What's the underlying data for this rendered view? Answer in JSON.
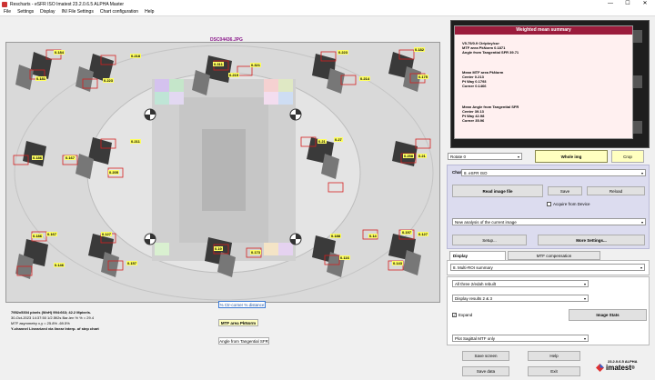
{
  "window": {
    "title": "Rescharts - eSFR ISO    Imatest 23.2.0.6.5  ALPHA  Master",
    "controls": [
      "—",
      "☐",
      "✕"
    ]
  },
  "menu": [
    "File",
    "Settings",
    "Display",
    "INI File Settings",
    "Chart configuration",
    "Help"
  ],
  "image": {
    "filename": "DSC04436.JPG",
    "labels": [
      "0.184",
      "0.218",
      "0.311",
      "0.321",
      "0.223",
      "0.182",
      "0.181",
      "0.223",
      "0.215",
      "0.214",
      "0.175",
      "0.186",
      "0.167",
      "0.211",
      "0.205",
      "0.21",
      "0.27",
      "0.258",
      "0.21",
      "0.186",
      "0.167",
      "0.127",
      "0.19",
      "0.173",
      "0.188",
      "0.14",
      "0.197",
      "0.127",
      "0.146",
      "0.157",
      "0.116",
      "0.143"
    ]
  },
  "info": {
    "line1": "7952x5304 pixels (WxH)  994:663;  42.2 Mpixels.",
    "line2": "30-Oct-2023 14:37:50    1/2.5f/2s    Bar-len % % = 29.4",
    "line3": "MTF asymmetry x,y = 25.8%  -69.5%",
    "line4": "Y-channel    Linearized via linear Interp. of step chart"
  },
  "center": {
    "dist_btn": "% Ctr-corner % distance",
    "mtf_btn": "MTF area PkNorm",
    "angle_btn": "Angle from Tangential SFR"
  },
  "summary": {
    "title": "Weighted mean summary",
    "block1": [
      "V5.75/0.9 Ctr/pkry/cur",
      "MTF area PkNorm  0.1871",
      "Angle from Tangential SFR  39.71"
    ],
    "block2": [
      "Mean MTF area PkNorm",
      "Center  0.213",
      "Pt Way  0.1793",
      "Corner  0.1466"
    ],
    "block3": [
      "Mean Angle from Tangential SFR",
      "Center  39.13",
      "Pt Way  42.98",
      "Corner  35.96"
    ]
  },
  "rotate": {
    "value": "Rotate 0"
  },
  "whole_img": "Whole img",
  "crop": "Crop",
  "chart": {
    "label": "Chart",
    "value": "8. eSFR ISO",
    "read_image": "Read image file",
    "save": "Save",
    "reload": "Reload",
    "acquire": "Acquire from Device",
    "analysis_value": "New analysis of the current image",
    "setup": "Setup...",
    "more_settings": "More Settings..."
  },
  "tabs": {
    "display": "Display",
    "mtf_comp": "MTF compensation"
  },
  "display": {
    "select1": "8. Multi-ROI summary",
    "select2": "All three 2/edah rebuilt",
    "select3": "Display results 2 & 3",
    "expand": "Expand",
    "image_stats": "Image Stats",
    "select4": "Plot Sagittal MTF only"
  },
  "bottom": {
    "save_screen": "Save screen",
    "help": "Help",
    "save_data": "Save data",
    "exit": "Exit",
    "version": "23.2.0.6.5 ALPHA",
    "logo": "imatest",
    "logo_mark": "®"
  }
}
